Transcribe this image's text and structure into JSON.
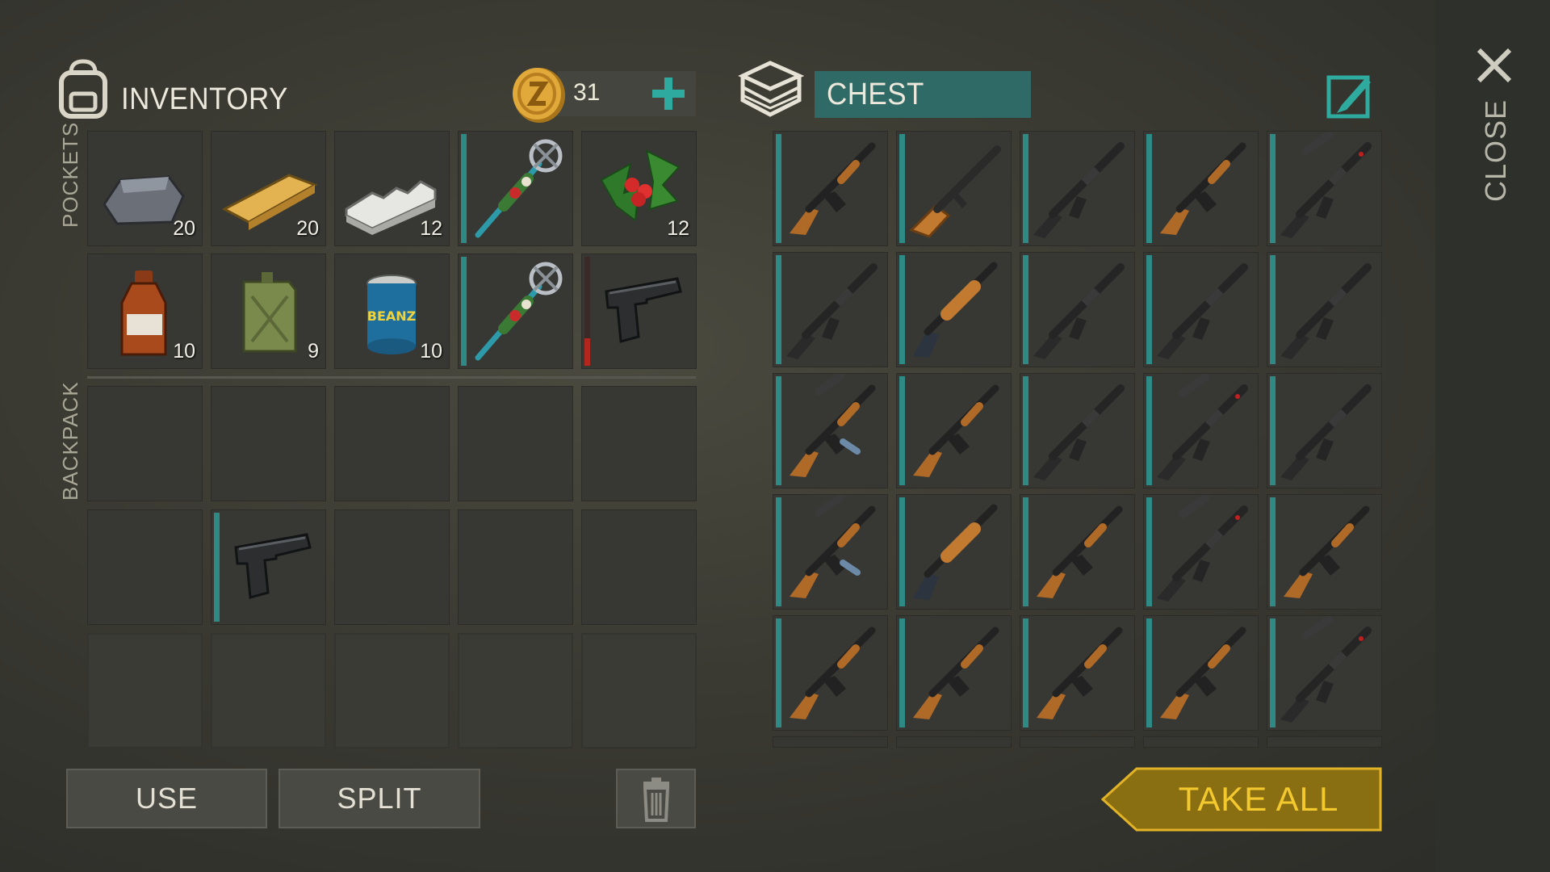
{
  "inventory": {
    "title": "INVENTORY",
    "coins": "31",
    "pockets_label": "POCKETS",
    "backpack_label": "BACKPACK",
    "pockets": [
      {
        "item": "iron-ingot",
        "qty": "20"
      },
      {
        "item": "wood-plank",
        "qty": "20"
      },
      {
        "item": "aluminum-bar",
        "qty": "12"
      },
      {
        "item": "christmas-staff",
        "qty": "",
        "durability": 1.0
      },
      {
        "item": "holly",
        "qty": "12"
      },
      {
        "item": "bottle",
        "qty": "10"
      },
      {
        "item": "jerrycan",
        "qty": "9"
      },
      {
        "item": "canned-beans",
        "qty": "10",
        "can_text": "BEANZ"
      },
      {
        "item": "christmas-staff",
        "qty": "",
        "durability": 1.0
      },
      {
        "item": "pistol",
        "qty": "",
        "durability": 0.25,
        "durability_color": "#b3261e"
      }
    ],
    "backpack": [
      {
        "item": ""
      },
      {
        "item": ""
      },
      {
        "item": ""
      },
      {
        "item": ""
      },
      {
        "item": ""
      },
      {
        "item": ""
      },
      {
        "item": "pistol",
        "durability": 1.0
      },
      {
        "item": ""
      },
      {
        "item": ""
      },
      {
        "item": ""
      },
      {
        "item": "locked"
      },
      {
        "item": "locked"
      },
      {
        "item": "locked"
      },
      {
        "item": "locked"
      },
      {
        "item": "locked"
      }
    ]
  },
  "chest": {
    "title": "CHEST",
    "items": [
      "ak",
      "shotgun-wood",
      "m4",
      "ak",
      "m4-suppressed",
      "m4",
      "shotgun",
      "m4",
      "m4",
      "m4",
      "ak-suppressed",
      "ak",
      "m4",
      "m4-suppressed",
      "m4",
      "ak-suppressed",
      "shotgun",
      "ak",
      "m4-suppressed",
      "ak",
      "ak",
      "ak",
      "ak",
      "ak",
      "m4-suppressed"
    ]
  },
  "buttons": {
    "use": "USE",
    "split": "SPLIT",
    "take_all": "TAKE ALL",
    "close": "CLOSE"
  },
  "colors": {
    "accent_teal": "#2f8a86",
    "take_all_gold": "#9b7d16",
    "take_all_text": "#f3c92e",
    "durability_low": "#b3261e"
  },
  "icons": {
    "header_inventory": "backpack-icon",
    "header_chest": "chest-box-icon",
    "coin": "coin-icon",
    "add": "plus-icon",
    "edit": "edit-icon",
    "trash": "trash-icon",
    "close": "close-x-icon"
  }
}
